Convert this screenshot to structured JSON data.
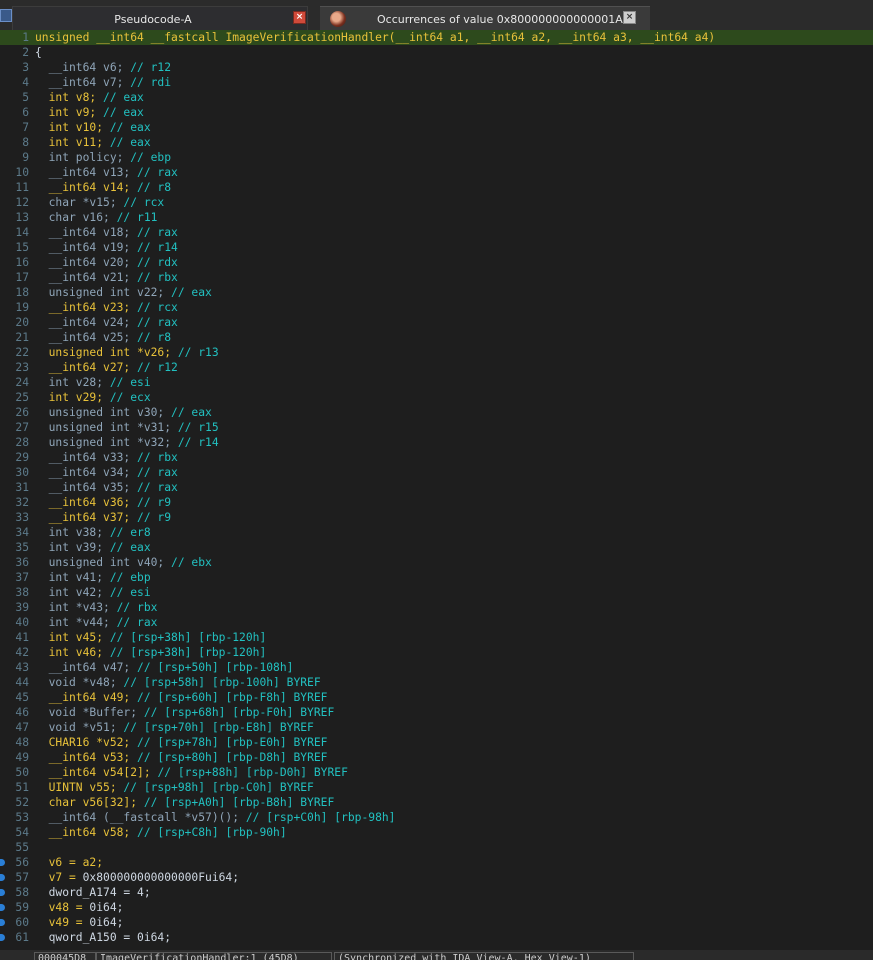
{
  "tabs": [
    {
      "label": "Pseudocode-A",
      "close": "×"
    },
    {
      "label": "Occurrences of value 0x800000000000001A",
      "close": "×"
    }
  ],
  "status": {
    "address": "000045D8",
    "location": "ImageVerificationHandler:1 (45D8)",
    "sync": "(Synchronized with IDA View-A, Hex View-1)"
  },
  "lines": [
    {
      "n": "1",
      "hl": true,
      "parts": [
        [
          "k",
          "unsigned __int64 __fastcall "
        ],
        [
          "k",
          "ImageVerificationHandler"
        ],
        [
          "k",
          "("
        ],
        [
          "k",
          "__int64 a1"
        ],
        [
          "k",
          ", "
        ],
        [
          "k",
          "__int64 a2"
        ],
        [
          "k",
          ", "
        ],
        [
          "k",
          "__int64 a3"
        ],
        [
          "k",
          ", "
        ],
        [
          "k",
          "__int64 a4"
        ],
        [
          "k",
          ")"
        ]
      ]
    },
    {
      "n": "2",
      "parts": [
        [
          "n",
          "{"
        ]
      ]
    },
    {
      "n": "3",
      "parts": [
        [
          "t",
          "  __int64 v6; "
        ],
        [
          "c",
          "// r12"
        ]
      ]
    },
    {
      "n": "4",
      "parts": [
        [
          "t",
          "  __int64 v7; "
        ],
        [
          "c",
          "// rdi"
        ]
      ]
    },
    {
      "n": "5",
      "parts": [
        [
          "k",
          "  int v8; "
        ],
        [
          "c",
          "// eax"
        ]
      ]
    },
    {
      "n": "6",
      "parts": [
        [
          "k",
          "  int v9; "
        ],
        [
          "c",
          "// eax"
        ]
      ]
    },
    {
      "n": "7",
      "parts": [
        [
          "k",
          "  int v10; "
        ],
        [
          "c",
          "// eax"
        ]
      ]
    },
    {
      "n": "8",
      "parts": [
        [
          "k",
          "  int v11; "
        ],
        [
          "c",
          "// eax"
        ]
      ]
    },
    {
      "n": "9",
      "parts": [
        [
          "t",
          "  int policy; "
        ],
        [
          "c",
          "// ebp"
        ]
      ]
    },
    {
      "n": "10",
      "parts": [
        [
          "t",
          "  __int64 v13; "
        ],
        [
          "c",
          "// rax"
        ]
      ]
    },
    {
      "n": "11",
      "parts": [
        [
          "k",
          "  __int64 v14; "
        ],
        [
          "c",
          "// r8"
        ]
      ]
    },
    {
      "n": "12",
      "parts": [
        [
          "t",
          "  char *v15; "
        ],
        [
          "c",
          "// rcx"
        ]
      ]
    },
    {
      "n": "13",
      "parts": [
        [
          "t",
          "  char v16; "
        ],
        [
          "c",
          "// r11"
        ]
      ]
    },
    {
      "n": "14",
      "parts": [
        [
          "t",
          "  __int64 v18; "
        ],
        [
          "c",
          "// rax"
        ]
      ]
    },
    {
      "n": "15",
      "parts": [
        [
          "t",
          "  __int64 v19; "
        ],
        [
          "c",
          "// r14"
        ]
      ]
    },
    {
      "n": "16",
      "parts": [
        [
          "t",
          "  __int64 v20; "
        ],
        [
          "c",
          "// rdx"
        ]
      ]
    },
    {
      "n": "17",
      "parts": [
        [
          "t",
          "  __int64 v21; "
        ],
        [
          "c",
          "// rbx"
        ]
      ]
    },
    {
      "n": "18",
      "parts": [
        [
          "t",
          "  unsigned int v22; "
        ],
        [
          "c",
          "// eax"
        ]
      ]
    },
    {
      "n": "19",
      "parts": [
        [
          "k",
          "  __int64 v23; "
        ],
        [
          "c",
          "// rcx"
        ]
      ]
    },
    {
      "n": "20",
      "parts": [
        [
          "t",
          "  __int64 v24; "
        ],
        [
          "c",
          "// rax"
        ]
      ]
    },
    {
      "n": "21",
      "parts": [
        [
          "t",
          "  __int64 v25; "
        ],
        [
          "c",
          "// r8"
        ]
      ]
    },
    {
      "n": "22",
      "parts": [
        [
          "k",
          "  unsigned int *v26; "
        ],
        [
          "c",
          "// r13"
        ]
      ]
    },
    {
      "n": "23",
      "parts": [
        [
          "k",
          "  __int64 v27; "
        ],
        [
          "c",
          "// r12"
        ]
      ]
    },
    {
      "n": "24",
      "parts": [
        [
          "t",
          "  int v28; "
        ],
        [
          "c",
          "// esi"
        ]
      ]
    },
    {
      "n": "25",
      "parts": [
        [
          "k",
          "  int v29; "
        ],
        [
          "c",
          "// ecx"
        ]
      ]
    },
    {
      "n": "26",
      "parts": [
        [
          "t",
          "  unsigned int v30; "
        ],
        [
          "c",
          "// eax"
        ]
      ]
    },
    {
      "n": "27",
      "parts": [
        [
          "t",
          "  unsigned int *v31; "
        ],
        [
          "c",
          "// r15"
        ]
      ]
    },
    {
      "n": "28",
      "parts": [
        [
          "t",
          "  unsigned int *v32; "
        ],
        [
          "c",
          "// r14"
        ]
      ]
    },
    {
      "n": "29",
      "parts": [
        [
          "t",
          "  __int64 v33; "
        ],
        [
          "c",
          "// rbx"
        ]
      ]
    },
    {
      "n": "30",
      "parts": [
        [
          "t",
          "  __int64 v34; "
        ],
        [
          "c",
          "// rax"
        ]
      ]
    },
    {
      "n": "31",
      "parts": [
        [
          "t",
          "  __int64 v35; "
        ],
        [
          "c",
          "// rax"
        ]
      ]
    },
    {
      "n": "32",
      "parts": [
        [
          "k",
          "  __int64 v36; "
        ],
        [
          "c",
          "// r9"
        ]
      ]
    },
    {
      "n": "33",
      "parts": [
        [
          "k",
          "  __int64 v37; "
        ],
        [
          "c",
          "// r9"
        ]
      ]
    },
    {
      "n": "34",
      "parts": [
        [
          "t",
          "  int v38; "
        ],
        [
          "c",
          "// er8"
        ]
      ]
    },
    {
      "n": "35",
      "parts": [
        [
          "t",
          "  int v39; "
        ],
        [
          "c",
          "// eax"
        ]
      ]
    },
    {
      "n": "36",
      "parts": [
        [
          "t",
          "  unsigned int v40; "
        ],
        [
          "c",
          "// ebx"
        ]
      ]
    },
    {
      "n": "37",
      "parts": [
        [
          "t",
          "  int v41; "
        ],
        [
          "c",
          "// ebp"
        ]
      ]
    },
    {
      "n": "38",
      "parts": [
        [
          "t",
          "  int v42; "
        ],
        [
          "c",
          "// esi"
        ]
      ]
    },
    {
      "n": "39",
      "parts": [
        [
          "t",
          "  int *v43; "
        ],
        [
          "c",
          "// rbx"
        ]
      ]
    },
    {
      "n": "40",
      "parts": [
        [
          "t",
          "  int *v44; "
        ],
        [
          "c",
          "// rax"
        ]
      ]
    },
    {
      "n": "41",
      "parts": [
        [
          "k",
          "  int v45; "
        ],
        [
          "c",
          "// [rsp+38h] [rbp-120h]"
        ]
      ]
    },
    {
      "n": "42",
      "parts": [
        [
          "k",
          "  int v46; "
        ],
        [
          "c",
          "// [rsp+38h] [rbp-120h]"
        ]
      ]
    },
    {
      "n": "43",
      "parts": [
        [
          "t",
          "  __int64 v47; "
        ],
        [
          "c",
          "// [rsp+50h] [rbp-108h]"
        ]
      ]
    },
    {
      "n": "44",
      "parts": [
        [
          "t",
          "  void *v48; "
        ],
        [
          "c",
          "// [rsp+58h] [rbp-100h] BYREF"
        ]
      ]
    },
    {
      "n": "45",
      "parts": [
        [
          "k",
          "  __int64 v49; "
        ],
        [
          "c",
          "// [rsp+60h] [rbp-F8h] BYREF"
        ]
      ]
    },
    {
      "n": "46",
      "parts": [
        [
          "t",
          "  void *Buffer; "
        ],
        [
          "c",
          "// [rsp+68h] [rbp-F0h] BYREF"
        ]
      ]
    },
    {
      "n": "47",
      "parts": [
        [
          "t",
          "  void *v51; "
        ],
        [
          "c",
          "// [rsp+70h] [rbp-E8h] BYREF"
        ]
      ]
    },
    {
      "n": "48",
      "parts": [
        [
          "k",
          "  CHAR16 *v52; "
        ],
        [
          "c",
          "// [rsp+78h] [rbp-E0h] BYREF"
        ]
      ]
    },
    {
      "n": "49",
      "parts": [
        [
          "k",
          "  __int64 v53; "
        ],
        [
          "c",
          "// [rsp+80h] [rbp-D8h] BYREF"
        ]
      ]
    },
    {
      "n": "50",
      "parts": [
        [
          "k",
          "  __int64 v54[2]; "
        ],
        [
          "c",
          "// [rsp+88h] [rbp-D0h] BYREF"
        ]
      ]
    },
    {
      "n": "51",
      "parts": [
        [
          "k",
          "  UINTN v55; "
        ],
        [
          "c",
          "// [rsp+98h] [rbp-C0h] BYREF"
        ]
      ]
    },
    {
      "n": "52",
      "parts": [
        [
          "k",
          "  char v56[32]; "
        ],
        [
          "c",
          "// [rsp+A0h] [rbp-B8h] BYREF"
        ]
      ]
    },
    {
      "n": "53",
      "parts": [
        [
          "t",
          "  __int64 (__fastcall *v57)(); "
        ],
        [
          "c",
          "// [rsp+C0h] [rbp-98h]"
        ]
      ]
    },
    {
      "n": "54",
      "parts": [
        [
          "k",
          "  __int64 v58; "
        ],
        [
          "c",
          "// [rsp+C8h] [rbp-90h]"
        ]
      ]
    },
    {
      "n": "55",
      "parts": []
    },
    {
      "n": "56",
      "bp": true,
      "parts": [
        [
          "k",
          "  v6 = a2;"
        ]
      ]
    },
    {
      "n": "57",
      "bp": true,
      "parts": [
        [
          "k",
          "  v7 = "
        ],
        [
          "n",
          "0x800000000000000Fui64;"
        ]
      ]
    },
    {
      "n": "58",
      "bp": true,
      "parts": [
        [
          "n",
          "  dword_A174 = 4;"
        ]
      ]
    },
    {
      "n": "59",
      "bp": true,
      "parts": [
        [
          "k",
          "  v48 = "
        ],
        [
          "n",
          "0i64;"
        ]
      ]
    },
    {
      "n": "60",
      "bp": true,
      "parts": [
        [
          "k",
          "  v49 = "
        ],
        [
          "n",
          "0i64;"
        ]
      ]
    },
    {
      "n": "61",
      "bp": true,
      "parts": [
        [
          "n",
          "  qword_A150 = 0i64;"
        ]
      ]
    }
  ]
}
